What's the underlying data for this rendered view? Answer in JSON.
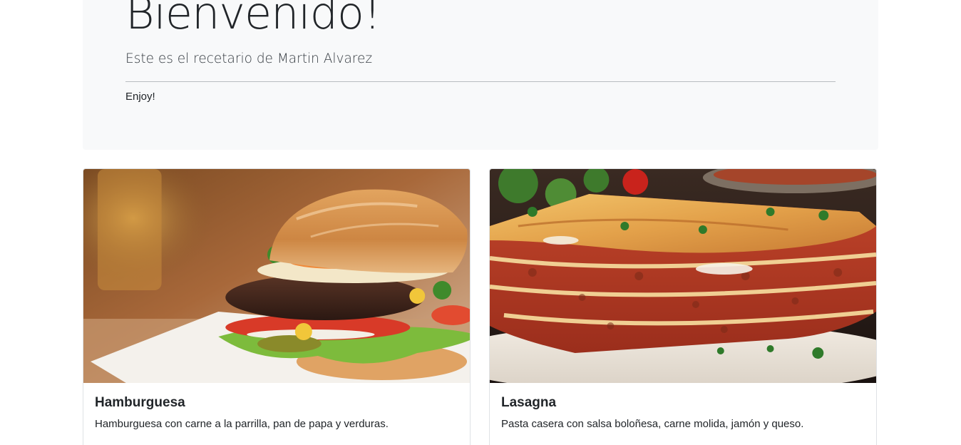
{
  "jumbotron": {
    "title": "Bienvenido!",
    "lead": "Este es el recetario de Martin Alvarez",
    "text": "Enjoy!"
  },
  "cards": [
    {
      "title": "Hamburguesa",
      "text": "Hamburguesa con carne a la parrilla, pan de papa y verduras.",
      "image_icon": "hamburger-photo"
    },
    {
      "title": "Lasagna",
      "text": "Pasta casera con salsa boloñesa, carne molida, jamón y queso.",
      "image_icon": "lasagna-photo"
    }
  ],
  "colors": {
    "jumbotron_bg": "#f8f9fa",
    "card_border": "#dfe2e5",
    "text": "#212529"
  }
}
